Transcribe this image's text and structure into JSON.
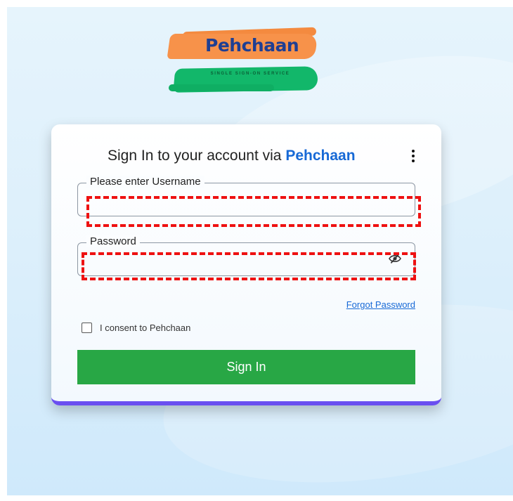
{
  "logo": {
    "brand": "Pehchaan",
    "tagline": "SINGLE SIGN-ON SERVICE"
  },
  "card": {
    "title_prefix": "Sign In to your account via",
    "title_brand": "Pehchaan",
    "username": {
      "label": "Please enter Username",
      "value": ""
    },
    "password": {
      "label": "Password",
      "value": ""
    },
    "forgot_password": "Forgot Password",
    "consent_label": "I consent to Pehchaan",
    "consent_checked": false,
    "signin_label": "Sign In"
  },
  "colors": {
    "brand_blue": "#1769d6",
    "button_green": "#28a745",
    "card_accent": "#6a4ff0",
    "highlight_red": "#ee1111",
    "logo_orange": "#f7924a",
    "logo_green": "#12b76a",
    "logo_text": "#1f3f93"
  },
  "icons": {
    "menu": "kebab-menu-icon",
    "password_toggle": "eye-slash-icon"
  }
}
